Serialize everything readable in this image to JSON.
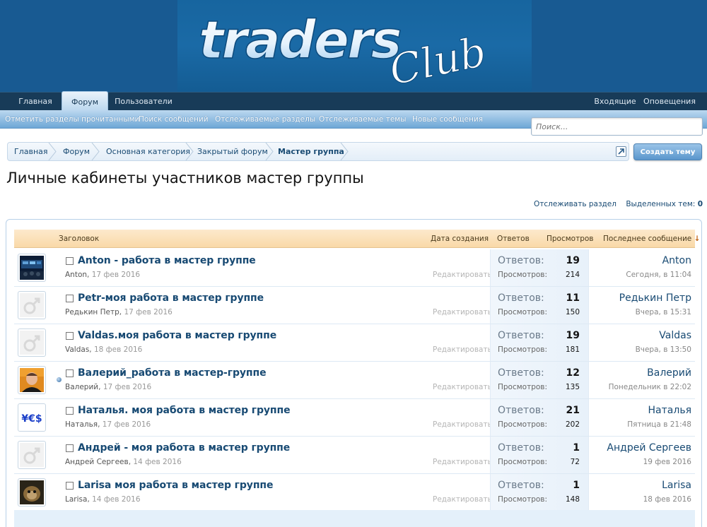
{
  "logo": {
    "text_main": "traders",
    "text_script": "Club",
    "bg_color": "#185a92"
  },
  "mainnav": {
    "left": [
      {
        "label": "Главная",
        "active": false
      },
      {
        "label": "Форум",
        "active": true
      },
      {
        "label": "Пользователи",
        "active": false
      }
    ],
    "right": [
      {
        "label": "Входящие"
      },
      {
        "label": "Оповещения"
      }
    ]
  },
  "subnav": [
    {
      "label": "Отметить разделы прочитанными"
    },
    {
      "label": "Поиск сообщений"
    },
    {
      "label": "Отслеживаемые разделы"
    },
    {
      "label": "Отслеживаемые темы"
    },
    {
      "label": "Новые сообщения"
    }
  ],
  "search": {
    "placeholder": "Поиск..."
  },
  "breadcrumb": [
    {
      "label": "Главная"
    },
    {
      "label": "Форум"
    },
    {
      "label": "Основная категория"
    },
    {
      "label": "Закрытый форум"
    },
    {
      "label": "Мастер группа",
      "current": true
    }
  ],
  "create_button": "Создать тему",
  "page_title": "Личные кабинеты участников мастер группы",
  "forum_tools": {
    "watch": "Отслеживать раздел",
    "selected_label": "Выделенных тем:",
    "selected_count": "0"
  },
  "columns": {
    "title": "Заголовок",
    "created": "Дата создания",
    "replies": "Ответов",
    "views": "Просмотров",
    "last": "Последнее сообщение",
    "sort_arrow": "↓"
  },
  "row_labels": {
    "replies": "Ответов:",
    "views": "Просмотров:",
    "edit": "Редактировать"
  },
  "threads": [
    {
      "title": "Anton - работа в мастер группе",
      "author": "Anton",
      "date": "17 фев 2016",
      "replies": "19",
      "views": "214",
      "last_user": "Anton",
      "last_date": "Сегодня, в 11:04",
      "avatar": "photo-trading",
      "unread": false
    },
    {
      "title": "Petr-моя работа в мастер группе",
      "author": "Редькин Петр",
      "date": "17 фев 2016",
      "replies": "11",
      "views": "150",
      "last_user": "Редькин Петр",
      "last_date": "Вчера, в 15:31",
      "avatar": "male-default",
      "unread": false
    },
    {
      "title": "Valdas.моя работа в мастер группе",
      "author": "Valdas",
      "date": "18 фев 2016",
      "replies": "19",
      "views": "181",
      "last_user": "Valdas",
      "last_date": "Вчера, в 13:50",
      "avatar": "male-default",
      "unread": false
    },
    {
      "title": "Валерий_работа в мастер-группе",
      "author": "Валерий",
      "date": "17 фев 2016",
      "replies": "12",
      "views": "135",
      "last_user": "Валерий",
      "last_date": "Понедельник в 22:02",
      "avatar": "photo-man",
      "unread": true
    },
    {
      "title": "Наталья. моя работа в мастер группе",
      "author": "Наталья",
      "date": "17 фев 2016",
      "replies": "21",
      "views": "202",
      "last_user": "Наталья",
      "last_date": "Пятница в 21:48",
      "avatar": "currency",
      "unread": false
    },
    {
      "title": "Андрей - моя работа в мастер группе",
      "author": "Андрей Сергеев",
      "date": "14 фев 2016",
      "replies": "1",
      "views": "72",
      "last_user": "Андрей Сергеев",
      "last_date": "19 фев 2016",
      "avatar": "male-default",
      "unread": false
    },
    {
      "title": "Larisa моя работа в мастер группе",
      "author": "Larisa",
      "date": "14 фев 2016",
      "replies": "1",
      "views": "148",
      "last_user": "Larisa",
      "last_date": "18 фев 2016",
      "avatar": "photo-animal",
      "unread": false
    }
  ],
  "colors": {
    "header_bg": "#185a92",
    "nav_bg": "#183b58",
    "link": "#184a73",
    "list_head": "#f9d9a8"
  },
  "icons": {
    "jump": "external-link-icon",
    "checkbox": "checkbox-icon",
    "unread": "unread-dot-icon"
  }
}
